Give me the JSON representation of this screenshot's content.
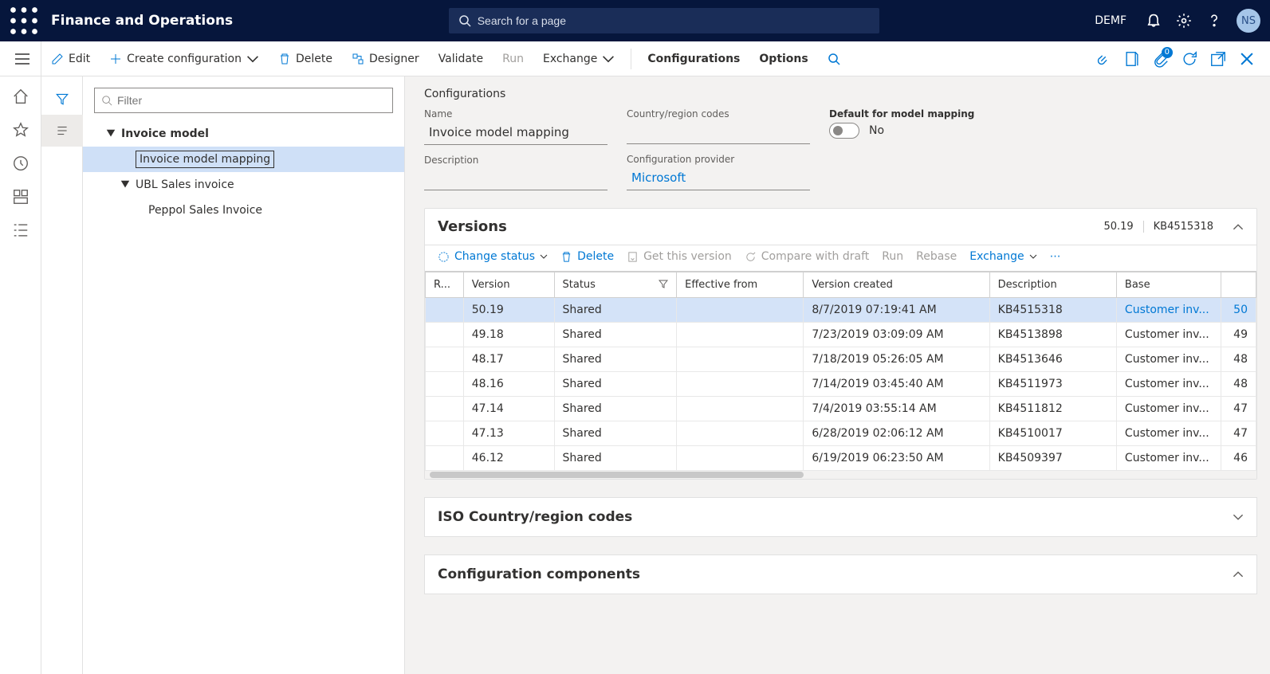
{
  "topnav": {
    "brand": "Finance and Operations",
    "search_placeholder": "Search for a page",
    "entity": "DEMF",
    "avatar": "NS"
  },
  "ribbon": {
    "edit": "Edit",
    "create": "Create configuration",
    "delete": "Delete",
    "designer": "Designer",
    "validate": "Validate",
    "run": "Run",
    "exchange": "Exchange",
    "configurations": "Configurations",
    "options": "Options",
    "attach_badge": "0"
  },
  "tree": {
    "filter_placeholder": "Filter",
    "nodes": [
      {
        "label": "Invoice model",
        "level": 1,
        "expanded": true
      },
      {
        "label": "Invoice model mapping",
        "level": 2,
        "selected": true
      },
      {
        "label": "UBL Sales invoice",
        "level": 2,
        "expanded": true
      },
      {
        "label": "Peppol Sales Invoice",
        "level": 3
      }
    ]
  },
  "config": {
    "heading": "Configurations",
    "labels": {
      "name": "Name",
      "region": "Country/region codes",
      "default": "Default for model mapping",
      "description": "Description",
      "provider": "Configuration provider"
    },
    "name": "Invoice model mapping",
    "region": "",
    "default_text": "No",
    "default_on": false,
    "description": "",
    "provider": "Microsoft"
  },
  "versions": {
    "title": "Versions",
    "summary_version": "50.19",
    "summary_kb": "KB4515318",
    "toolbar": {
      "change_status": "Change status",
      "delete": "Delete",
      "get": "Get this version",
      "compare": "Compare with draft",
      "run": "Run",
      "rebase": "Rebase",
      "exchange": "Exchange"
    },
    "columns": {
      "r": "R...",
      "version": "Version",
      "status": "Status",
      "effective": "Effective from",
      "created": "Version created",
      "description": "Description",
      "base": "Base",
      "extra": ""
    },
    "rows": [
      {
        "version": "50.19",
        "status": "Shared",
        "effective": "",
        "created": "8/7/2019 07:19:41 AM",
        "description": "KB4515318",
        "base": "Customer inv...",
        "n": "50",
        "selected": true
      },
      {
        "version": "49.18",
        "status": "Shared",
        "effective": "",
        "created": "7/23/2019 03:09:09 AM",
        "description": "KB4513898",
        "base": "Customer inv...",
        "n": "49"
      },
      {
        "version": "48.17",
        "status": "Shared",
        "effective": "",
        "created": "7/18/2019 05:26:05 AM",
        "description": "KB4513646",
        "base": "Customer inv...",
        "n": "48"
      },
      {
        "version": "48.16",
        "status": "Shared",
        "effective": "",
        "created": "7/14/2019 03:45:40 AM",
        "description": "KB4511973",
        "base": "Customer inv...",
        "n": "48"
      },
      {
        "version": "47.14",
        "status": "Shared",
        "effective": "",
        "created": "7/4/2019 03:55:14 AM",
        "description": "KB4511812",
        "base": "Customer inv...",
        "n": "47"
      },
      {
        "version": "47.13",
        "status": "Shared",
        "effective": "",
        "created": "6/28/2019 02:06:12 AM",
        "description": "KB4510017",
        "base": "Customer inv...",
        "n": "47"
      },
      {
        "version": "46.12",
        "status": "Shared",
        "effective": "",
        "created": "6/19/2019 06:23:50 AM",
        "description": "KB4509397",
        "base": "Customer inv...",
        "n": "46"
      }
    ]
  },
  "iso_panel": "ISO Country/region codes",
  "components_panel": "Configuration components"
}
